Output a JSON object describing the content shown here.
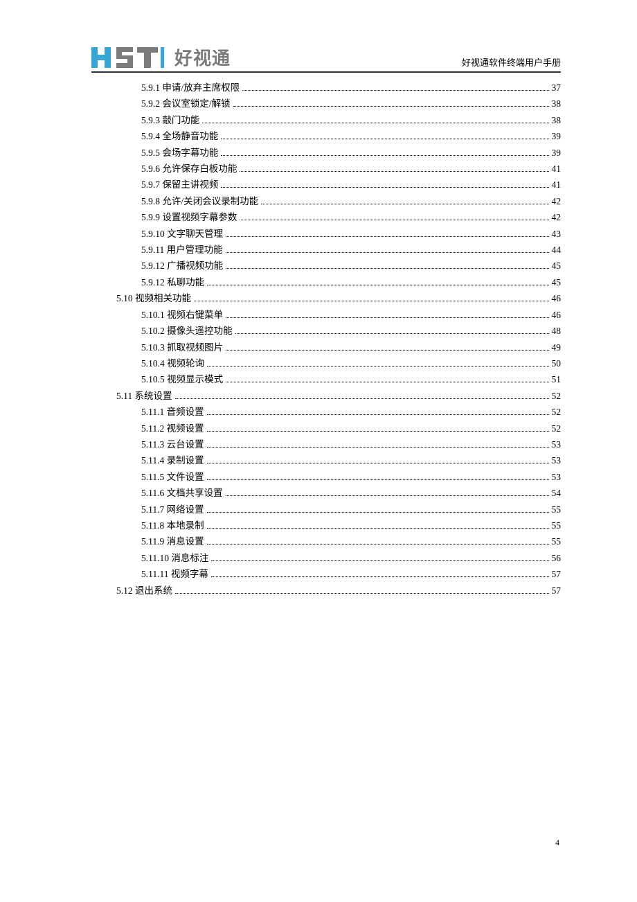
{
  "header": {
    "logo_cn": "好视通",
    "doc_title": "好视通软件终端用户手册"
  },
  "toc": [
    {
      "level": 3,
      "num": "5.9.1",
      "title": "申请/放弃主席权限",
      "page": "37"
    },
    {
      "level": 3,
      "num": "5.9.2",
      "title": "会议室锁定/解锁",
      "page": "38"
    },
    {
      "level": 3,
      "num": "5.9.3",
      "title": "敲门功能",
      "page": "38"
    },
    {
      "level": 3,
      "num": "5.9.4",
      "title": "全场静音功能",
      "page": "39"
    },
    {
      "level": 3,
      "num": "5.9.5",
      "title": "会场字幕功能",
      "page": "39"
    },
    {
      "level": 3,
      "num": "5.9.6",
      "title": "允许保存白板功能",
      "page": "41"
    },
    {
      "level": 3,
      "num": "5.9.7",
      "title": "保留主讲视频",
      "page": "41"
    },
    {
      "level": 3,
      "num": "5.9.8",
      "title": "允许/关闭会议录制功能",
      "page": "42"
    },
    {
      "level": 3,
      "num": "5.9.9",
      "title": "设置视频字幕参数",
      "page": "42"
    },
    {
      "level": 3,
      "num": "5.9.10",
      "title": "文字聊天管理",
      "page": "43"
    },
    {
      "level": 3,
      "num": "5.9.11",
      "title": "用户管理功能",
      "page": "44"
    },
    {
      "level": 3,
      "num": "5.9.12",
      "title": "广播视频功能",
      "page": "45"
    },
    {
      "level": 3,
      "num": "5.9.12",
      "title": "私聊功能",
      "page": "45"
    },
    {
      "level": 2,
      "num": "5.10",
      "title": "视频相关功能",
      "page": "46"
    },
    {
      "level": 3,
      "num": "5.10.1",
      "title": "视频右键菜单",
      "page": "46"
    },
    {
      "level": 3,
      "num": "5.10.2",
      "title": "摄像头遥控功能",
      "page": "48"
    },
    {
      "level": 3,
      "num": "5.10.3",
      "title": "抓取视频图片",
      "page": "49"
    },
    {
      "level": 3,
      "num": "5.10.4",
      "title": "视频轮询",
      "page": "50"
    },
    {
      "level": 3,
      "num": "5.10.5",
      "title": "视频显示模式",
      "page": "51"
    },
    {
      "level": 2,
      "num": "5.11",
      "title": "系统设置",
      "page": "52"
    },
    {
      "level": 3,
      "num": "5.11.1",
      "title": "音频设置",
      "page": "52"
    },
    {
      "level": 3,
      "num": "5.11.2",
      "title": "视频设置",
      "page": "52"
    },
    {
      "level": 3,
      "num": "5.11.3",
      "title": "云台设置",
      "page": "53"
    },
    {
      "level": 3,
      "num": "5.11.4",
      "title": "录制设置",
      "page": "53"
    },
    {
      "level": 3,
      "num": "5.11.5",
      "title": "文件设置",
      "page": "53"
    },
    {
      "level": 3,
      "num": "5.11.6",
      "title": "文档共享设置",
      "page": "54"
    },
    {
      "level": 3,
      "num": "5.11.7",
      "title": "网络设置",
      "page": "55"
    },
    {
      "level": 3,
      "num": "5.11.8",
      "title": "本地录制",
      "page": "55"
    },
    {
      "level": 3,
      "num": "5.11.9",
      "title": "消息设置",
      "page": "55"
    },
    {
      "level": 3,
      "num": "5.11.10",
      "title": "消息标注",
      "page": "56"
    },
    {
      "level": 3,
      "num": "5.11.11",
      "title": "视频字幕",
      "page": "57"
    },
    {
      "level": 2,
      "num": "5.12",
      "title": "退出系统",
      "page": "57"
    }
  ],
  "footer": {
    "page_number": "4"
  }
}
